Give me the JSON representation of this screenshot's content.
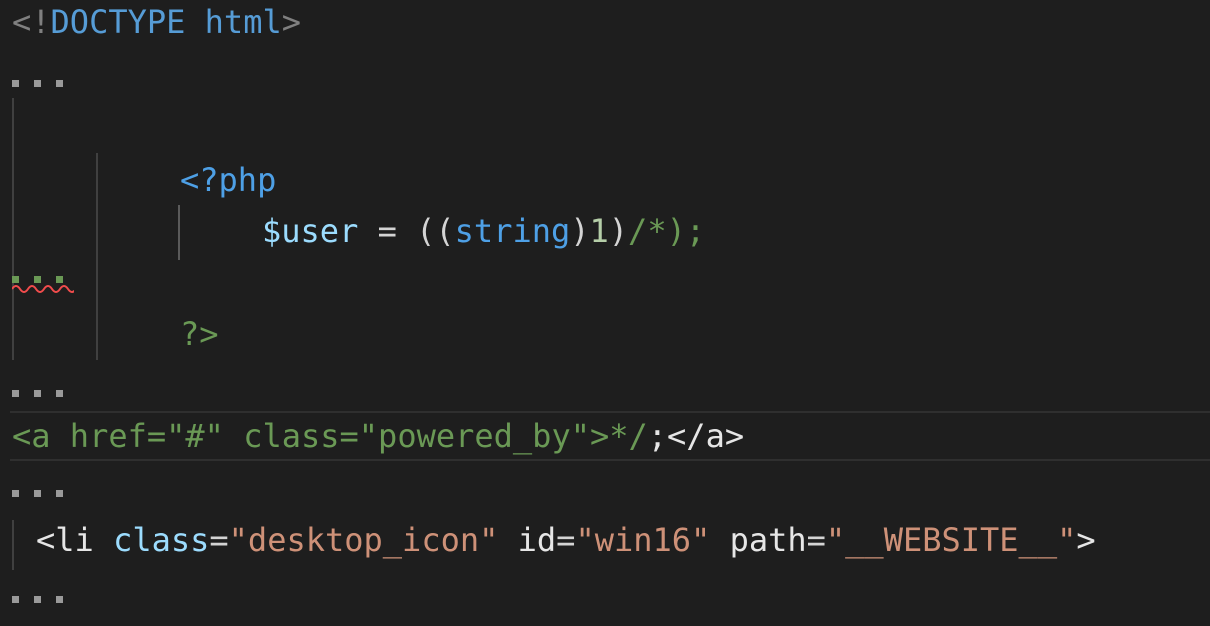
{
  "code": {
    "doctype": {
      "open": "<!",
      "keyword": "DOCTYPE",
      "space": " ",
      "name": "html",
      "close": ">"
    },
    "php_open": "<?php",
    "php_statement": {
      "variable": "$user",
      "equals": " = ",
      "paren_open": "((",
      "type": "string",
      "paren_close": ")",
      "number": "1",
      "trailing": ")",
      "comment_open": "/*",
      "semicolon": ");"
    },
    "php_close": "?>",
    "anchor_line": {
      "text": "<a href=\"#\" class=\"powered_by\">",
      "comment_close": "*/",
      "semicolon": ";",
      "close_tag": "</a>"
    },
    "li_line": {
      "open": "<li",
      "attr1_name": " class",
      "eq1": "=",
      "attr1_value": "\"desktop_icon\"",
      "attr2_name": " id",
      "eq2": "=",
      "attr2_value": "\"win16\"",
      "attr3_name": " path",
      "eq3": "=",
      "attr3_value": "\"__WEBSITE__\"",
      "close": ">"
    }
  },
  "colors": {
    "background": "#1e1e1e",
    "tag": "#569cd6",
    "string": "#ce9178",
    "comment": "#6a9955",
    "number": "#b5cea8",
    "variable": "#9cdcfe",
    "error_squiggle": "#f14c4c"
  }
}
